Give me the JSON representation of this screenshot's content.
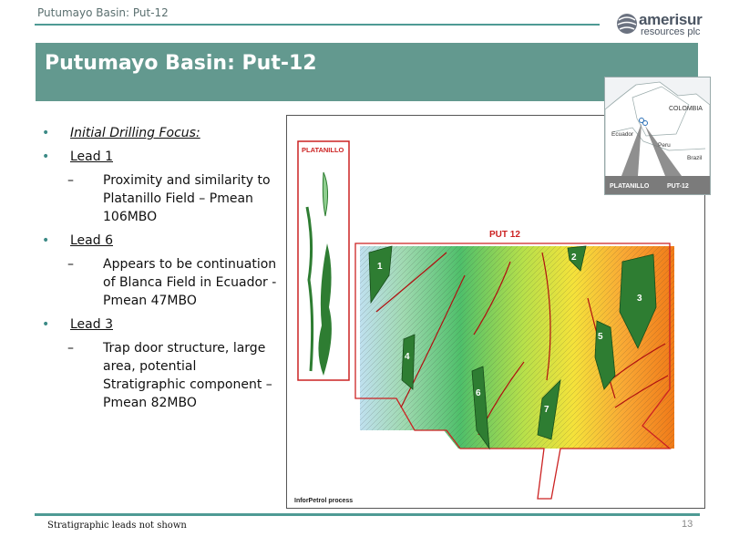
{
  "header": {
    "label": "Putumayo Basin: Put-12"
  },
  "logo": {
    "word": "amerisur",
    "sub": "resources plc"
  },
  "title": "Putumayo Basin: Put-12",
  "bullets": [
    {
      "text": "Initial Drilling Focus:",
      "subs": []
    },
    {
      "text": "Lead 1",
      "subs": [
        "Proximity and similarity to Platanillo Field – Pmean 106MBO"
      ]
    },
    {
      "text": "Lead 6",
      "subs": [
        "Appears to be continuation of Blanca Field in Ecuador - Pmean 47MBO"
      ]
    },
    {
      "text": "Lead 3",
      "subs": [
        "Trap door structure, large area, potential Stratigraphic component – Pmean 82MBO"
      ]
    }
  ],
  "map": {
    "platanillo_label": "PLATANILLO",
    "put12_label": "PUT 12",
    "credit": "InforPetrol process",
    "lead_numbers": [
      "1",
      "2",
      "3",
      "4",
      "5",
      "6",
      "7"
    ]
  },
  "inset": {
    "colombia": "COLOMBIA",
    "ecuador": "Ecuador",
    "peru": "Peru",
    "brazil": "Brazil",
    "platanillo": "PLATANILLO",
    "put12": "PUT-12"
  },
  "footer": {
    "note": "Stratigraphic leads not shown",
    "page": "13"
  },
  "colors": {
    "teal": "#63998f",
    "rule": "#4e9a94",
    "lead_green": "#2e7d32",
    "boundary_red": "#cc2222"
  }
}
